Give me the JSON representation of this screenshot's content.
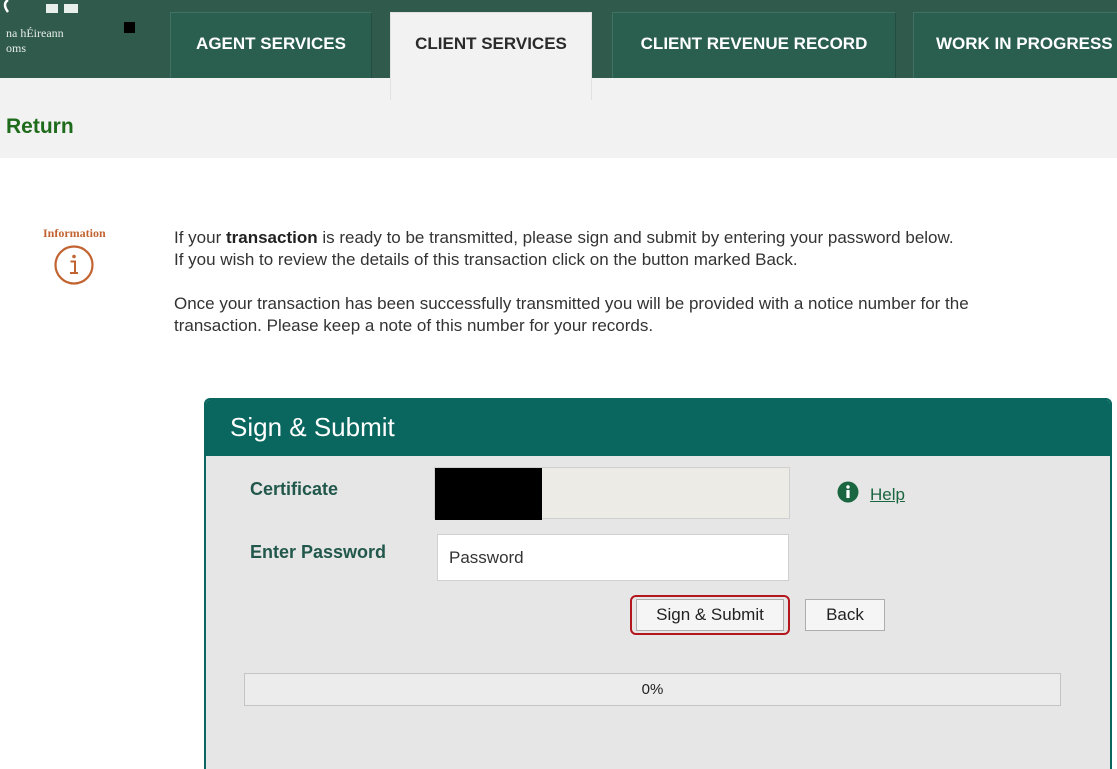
{
  "header": {
    "logo_text": "na hÉireann\noms",
    "tabs": [
      {
        "label": "AGENT SERVICES",
        "active": false
      },
      {
        "label": "CLIENT SERVICES",
        "active": true
      },
      {
        "label": "CLIENT REVENUE RECORD",
        "active": false
      },
      {
        "label": "WORK IN PROGRESS",
        "active": false
      }
    ]
  },
  "page": {
    "title": "Return"
  },
  "info": {
    "label": "Information",
    "icon": "info-icon",
    "para1": {
      "line1_before": "If your ",
      "line1_bold": "transaction",
      "line1_after": " is ready to be transmitted, please sign and submit by entering your password below.",
      "line2": "If you wish to review the details of this transaction click on the button marked Back."
    },
    "para2": {
      "line1": "Once your transaction has been successfully transmitted you will be provided with a notice number for the",
      "line2": "transaction. Please keep a note of this number for your records."
    }
  },
  "sign_submit": {
    "title": "Sign & Submit",
    "certificate_label": "Certificate",
    "password_label": "Enter Password",
    "password_placeholder": "Password",
    "help_label": "Help",
    "help_icon": "info-circle-icon",
    "sign_button_label": "Sign & Submit",
    "back_button_label": "Back",
    "progress": {
      "percent": 0,
      "label": "0%"
    }
  },
  "colors": {
    "header_bg": "#2f5a4c",
    "tab_bg": "#2a5e4f",
    "panel_accent": "#0a6760",
    "title_green": "#1f6b1c",
    "info_orange": "#c26431",
    "highlight_red": "#b3161d"
  }
}
